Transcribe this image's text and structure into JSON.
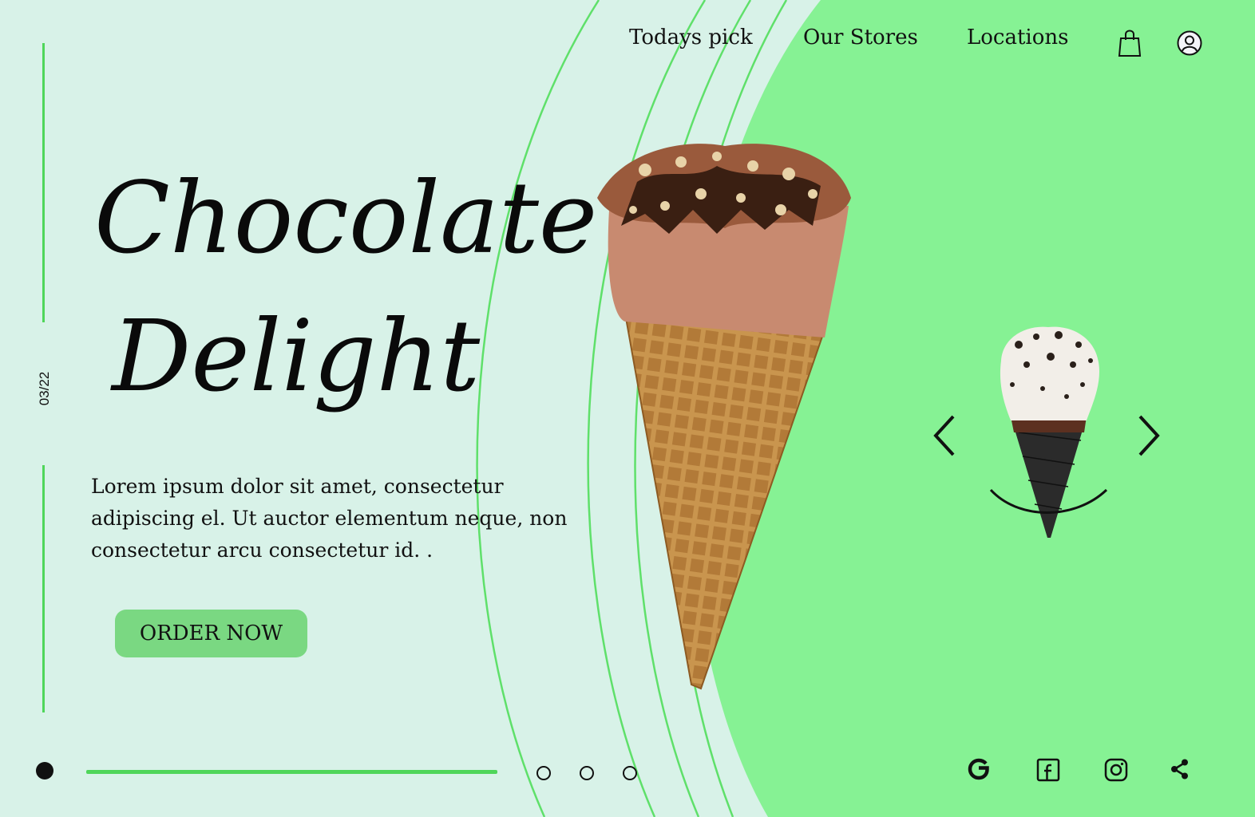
{
  "colors": {
    "page_bg": "#d8f2e8",
    "accent_green": "#86f294",
    "line_green": "#4fd65a",
    "button_green": "#7ad882"
  },
  "nav": {
    "items": [
      {
        "label": "Todays pick"
      },
      {
        "label": "Our Stores"
      },
      {
        "label": "Locations"
      }
    ],
    "icons": [
      "shopping-bag-icon",
      "user-profile-icon"
    ]
  },
  "hero": {
    "title_line1": "Chocolate",
    "title_line2": "Delight",
    "slide_counter": "03/22",
    "description": "Lorem ipsum dolor sit amet, consectetur adipiscing el. Ut auctor elementum neque, non consectetur arcu consectetur id. .",
    "cta_label": "ORDER NOW"
  },
  "carousel": {
    "dots": [
      "active",
      "inactive",
      "inactive",
      "inactive"
    ],
    "prev_icon": "chevron-left-icon",
    "next_icon": "chevron-right-icon"
  },
  "social": [
    "google-icon",
    "facebook-icon",
    "instagram-icon",
    "share-icon"
  ]
}
